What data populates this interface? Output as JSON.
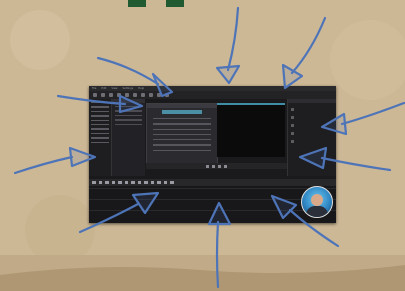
{
  "scene": {
    "background_color": "#cdb896",
    "arrow_color": "#4e74b8",
    "logo_color": "#1f5a31"
  },
  "app": {
    "menu_items": [
      "File",
      "Edit",
      "View",
      "Settings",
      "Help"
    ],
    "accent_color": "#4b8fa5"
  },
  "icons": {
    "webcam": "presenter-avatar"
  }
}
